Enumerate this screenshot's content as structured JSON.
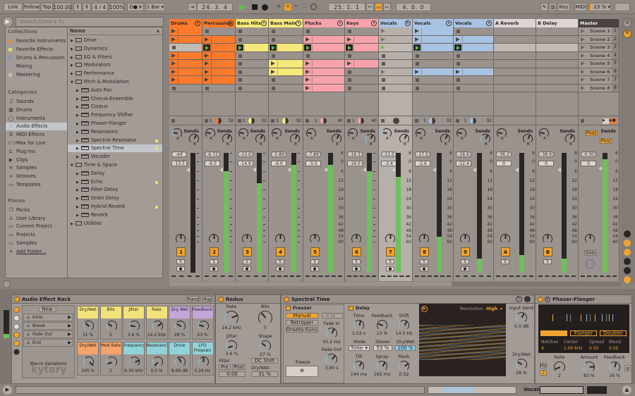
{
  "toolbar": {
    "link": "Link",
    "follow": "Follow",
    "tap": "Tap",
    "tempo": "100.00",
    "signature": "4 / 4",
    "groove": "100%",
    "metro": "O●",
    "quantize": "1 Bar",
    "arrangement_position": "24.  3.  4",
    "loop_start": "25.  1.  1",
    "loop_length": "4.  0.  0",
    "key": "Key",
    "midi": "MIDI",
    "cpu": "23 %",
    "accent": "#f0a430"
  },
  "browser": {
    "search_placeholder": "Search (Cmd + F)",
    "collections_header": "Collections",
    "collections": [
      {
        "label": "Favorite Instruments",
        "color": "#e8913a"
      },
      {
        "label": "Favorite Effects",
        "color": "#e8d95a"
      },
      {
        "label": "Drums & Percussion",
        "color": "#7c98c0"
      },
      {
        "label": "Mixing",
        "color": "#b094c0"
      },
      {
        "label": "Mastering",
        "color": "#c4bcb8"
      }
    ],
    "categories_header": "Categories",
    "categories": [
      {
        "label": "Sounds",
        "icon": "♫"
      },
      {
        "label": "Drums",
        "icon": "▦"
      },
      {
        "label": "Instruments",
        "icon": "◯"
      },
      {
        "label": "Audio Effects",
        "icon": "⫶",
        "selected": true
      },
      {
        "label": "MIDI Effects",
        "icon": "☰"
      },
      {
        "label": "Max for Live",
        "icon": "⊂⊃"
      },
      {
        "label": "Plug-Ins",
        "icon": "⊏"
      },
      {
        "label": "Clips",
        "icon": "▶"
      },
      {
        "label": "Samples",
        "icon": "≡"
      },
      {
        "label": "Grooves",
        "icon": "≈"
      },
      {
        "label": "Templates",
        "icon": "▭"
      }
    ],
    "places_header": "Places",
    "places": [
      {
        "label": "Packs",
        "icon": "❐"
      },
      {
        "label": "User Library",
        "icon": "♙"
      },
      {
        "label": "Current Project",
        "icon": "▭"
      },
      {
        "label": "Projects",
        "icon": "▭"
      },
      {
        "label": "Samples",
        "icon": "▭"
      },
      {
        "label": "Add Folder...",
        "icon": "+"
      }
    ],
    "name_header": "Name",
    "items": [
      {
        "label": "Drive",
        "type": "folder",
        "level": 0
      },
      {
        "label": "Dynamics",
        "type": "folder",
        "level": 0
      },
      {
        "label": "EQ & Filters",
        "type": "folder",
        "level": 0
      },
      {
        "label": "Modulators",
        "type": "folder",
        "level": 0
      },
      {
        "label": "Performance",
        "type": "folder",
        "level": 0
      },
      {
        "label": "Pitch & Modulation",
        "type": "folder",
        "level": 0,
        "open": true
      },
      {
        "label": "Auto Pan",
        "type": "device",
        "level": 1
      },
      {
        "label": "Chorus-Ensemble",
        "type": "device",
        "level": 1
      },
      {
        "label": "Corpus",
        "type": "device",
        "level": 1
      },
      {
        "label": "Frequency Shifter",
        "type": "device",
        "level": 1
      },
      {
        "label": "Phaser-Flanger",
        "type": "device",
        "level": 1
      },
      {
        "label": "Resonators",
        "type": "device",
        "level": 1
      },
      {
        "label": "Spectral Resonator",
        "type": "device",
        "level": 1,
        "new": true
      },
      {
        "label": "Spectral Time",
        "type": "device",
        "level": 1,
        "new": true,
        "selected": true
      },
      {
        "label": "Vocoder",
        "type": "device",
        "level": 1
      },
      {
        "label": "Time & Space",
        "type": "folder",
        "level": 0,
        "open": true
      },
      {
        "label": "Delay",
        "type": "device",
        "level": 1
      },
      {
        "label": "Echo",
        "type": "device",
        "level": 1,
        "new": true
      },
      {
        "label": "Filter Delay",
        "type": "device",
        "level": 1
      },
      {
        "label": "Grain Delay",
        "type": "device",
        "level": 1
      },
      {
        "label": "Hybrid Reverb",
        "type": "device",
        "level": 1,
        "new": true
      },
      {
        "label": "Reverb",
        "type": "device",
        "level": 1
      },
      {
        "label": "Utilities",
        "type": "folder",
        "level": 0
      }
    ]
  },
  "session": {
    "tracks": [
      {
        "name": "Drums",
        "color": "#fb7a2c",
        "slots": [
          "clip",
          "clip",
          "stop",
          "clip",
          "clip",
          "clip",
          "clip",
          "stop"
        ],
        "vol": "-Inf",
        "vol2": "-13.5",
        "num": "1",
        "meter": 0
      },
      {
        "name": "Percussion",
        "color": "#fb7a2c",
        "slots": [
          "stop",
          "clip",
          "playing",
          "clip",
          "clip",
          "clip",
          "clip",
          "stop"
        ],
        "vol": "-6.72",
        "vol2": "-6.0",
        "num": "2",
        "io": [
          "1",
          "32"
        ],
        "meter": 0.85
      },
      {
        "name": "Bass Hits",
        "color": "#f5e97a",
        "slots": [
          "stop",
          "stop",
          "playing",
          "stop",
          "stop",
          "stop",
          "stop",
          "stop"
        ],
        "vol": "-13.0",
        "vol2": "-14.9",
        "num": "3",
        "io": [
          "1",
          "32"
        ],
        "meter": 0.75
      },
      {
        "name": "Bass Main",
        "color": "#f5e97a",
        "slots": [
          "stop",
          "stop",
          "playing",
          "stop",
          "clip",
          "clip",
          "stop",
          "stop"
        ],
        "vol": "-5.89",
        "vol2": "-6.0",
        "num": "4",
        "io": [
          "1",
          "32"
        ],
        "meter": 0.9
      },
      {
        "name": "Plucks",
        "color": "#f6a3ab",
        "slots": [
          "stop",
          "clip",
          "playing",
          "stop",
          "clip",
          "clip",
          "clip",
          "clip"
        ],
        "vol": "-7.89",
        "vol2": "-5.5",
        "num": "5",
        "io": [
          "1",
          "40"
        ],
        "meter": 0.9,
        "scale": true
      },
      {
        "name": "Keys",
        "color": "#f6a3ab",
        "slots": [
          "stop",
          "clip",
          "playing",
          "stop",
          "clip",
          "stop",
          "stop",
          "stop"
        ],
        "vol": "-16.3",
        "vol2": "-16.0",
        "num": "6",
        "io": [
          "1",
          "40"
        ],
        "meter": 0.85
      },
      {
        "name": "Vocals",
        "color": "#a9c3e2",
        "group": true,
        "slots": [
          "gplay",
          "gplay",
          "gplaying",
          "gstop",
          "gstop",
          "gplay",
          "gstop",
          "gstop"
        ],
        "vol": "-11.5",
        "vol2": "-3.4",
        "num": "7",
        "meter": 0.8,
        "scale": true
      },
      {
        "name": "Vocals",
        "color": "#a9c3e2",
        "slots": [
          "clip",
          "clip",
          "playing",
          "stop",
          "stop",
          "clip",
          "stop",
          "stop"
        ],
        "vol": "-17.5",
        "vol2": "-2.6",
        "num": "8",
        "io": [
          "1",
          "32"
        ],
        "meter": 0.3,
        "scale": true
      },
      {
        "name": "Vocals",
        "color": "#a9c3e2",
        "slots": [
          "stop",
          "clip",
          "playing",
          "stop",
          "stop",
          "clip",
          "stop",
          "stop"
        ],
        "vol": "-16.6",
        "vol2": "-12.4",
        "num": "9",
        "io": [
          "1",
          "32"
        ],
        "meter": 0.12,
        "scale": true
      },
      {
        "name": "A Reverb",
        "color": "#ddd5d1",
        "return": true,
        "slots": [
          "",
          "",
          "",
          "",
          "",
          "",
          "",
          ""
        ],
        "vol": "-36.2",
        "vol2": "0",
        "num": "A",
        "meter": 0.15,
        "scale": true
      },
      {
        "name": "B Delay",
        "color": "#ddd5d1",
        "return": true,
        "slots": [
          "",
          "",
          "",
          "",
          "",
          "",
          "",
          ""
        ],
        "vol": "-38.9",
        "vol2": "0",
        "num": "B",
        "meter": 0.12,
        "scale": true
      },
      {
        "name": "Master",
        "color": "#4a4340",
        "master": true,
        "vol": "-0.30",
        "vol2": "0",
        "solo": "Solo",
        "post": "Post",
        "meter": 0.95,
        "scale": true
      }
    ],
    "scenes": [
      "Scene 1",
      "Scene 2",
      "Scene 3",
      "Scene 4",
      "Scene 5",
      "Scene 6",
      "Scene 7",
      "Scene 8"
    ],
    "scene_numbers": [
      "1",
      "2",
      "3",
      "4",
      "5",
      "6",
      "7",
      "8"
    ],
    "sends_label": "Sends",
    "send_a": "A",
    "send_b": "B",
    "solo_label": "S",
    "meter_scale": [
      "6",
      "0",
      "6",
      "12",
      "18",
      "24",
      "30",
      "36",
      "42",
      "48",
      "54",
      "60"
    ]
  },
  "devices": {
    "rack": {
      "title": "Audio Effect Rack",
      "rand": "Rand",
      "map": "Map",
      "new": "New",
      "variations": [
        "Intro",
        "Break",
        "Fade Out",
        "End"
      ],
      "variations_label": "Macro Variations",
      "watermark": "kytary",
      "macros": [
        {
          "label": "Dry/Wet",
          "value": "31 %",
          "color": "#f2e27a",
          "level": 0.31
        },
        {
          "label": "Bits",
          "value": "5",
          "color": "#f2e27a",
          "level": 0.3
        },
        {
          "label": "Jitter",
          "value": "3.6 %",
          "color": "#f2e27a",
          "level": 0.2
        },
        {
          "label": "Rate",
          "value": "14.2 kHz",
          "color": "#f2e27a",
          "level": 0.7
        },
        {
          "label": "Dry Wet",
          "value": "28 %",
          "color": "#c3a6d8",
          "level": 0.28
        },
        {
          "label": "Feedback",
          "value": "23 %",
          "color": "#c3a6d8",
          "level": 0.23
        },
        {
          "label": "Dry/Wet",
          "value": "100 %",
          "color": "#f5a36a",
          "level": 1
        },
        {
          "label": "Mod Rate",
          "value": "2",
          "color": "#f5a36a",
          "level": 0.1
        },
        {
          "label": "Frequency",
          "value": "6.30 kHz",
          "color": "#8fd3d8",
          "level": 0.75
        },
        {
          "label": "Resonance",
          "value": "0.0 %",
          "color": "#8fd3d8",
          "level": 0
        },
        {
          "label": "Drive",
          "value": "8.69 dB",
          "color": "#8fd3d8",
          "level": 0.4
        },
        {
          "label": "LFO Frequen",
          "value": "0.26 Hz",
          "color": "#8fd3d8",
          "level": 0.5
        }
      ]
    },
    "redux": {
      "title": "Redux",
      "rate_label": "Rate",
      "rate": "14.2 kHz",
      "bits_label": "Bits",
      "bits": "5",
      "jitter_label": "Jitter",
      "jitter": "3.6 %",
      "shape_label": "Shape",
      "shape": "27 %",
      "filter_label": "Filter",
      "pre": "Pre",
      "post": "Post",
      "filter_value": "0.00",
      "dc_shift": "DC Shift",
      "drywet_label": "Dry/Wet",
      "drywet": "31 %"
    },
    "spectral_time": {
      "title": "Spectral Time",
      "freezer": "Freezer",
      "manual": "Manual",
      "retrigger": "Retrigger",
      "onsets": "Onsets",
      "sync": "Sync",
      "freeze_label": "Freeze",
      "freeze_symbol": "✳",
      "fade_in_label": "Fade In",
      "fade_in": "55.2 ms",
      "fade_out_label": "Fade Out",
      "fade_out": "3.90 s",
      "delay": "Delay",
      "time_label": "Time",
      "time": "1.03 s",
      "feedback_label": "Feedback",
      "feedback": "23 %",
      "shift_label": "Shift",
      "shift": "14.0 Hz",
      "mode_label": "Mode",
      "mode": "Time",
      "stereo_label": "Stereo",
      "stereo": "53 %",
      "drywet_label": "Dry/Wet",
      "drywet": "100 %",
      "tilt_label": "Tilt",
      "tilt": "144 ms",
      "spray_label": "Spray",
      "spray": "165 ms",
      "mask_label": "Mask",
      "mask": "0.52",
      "resolution_label": "Resolution",
      "resolution": "High",
      "input_send_label": "Input Send",
      "input_send": "0.0 dB",
      "out_drywet_label": "Dry/Wet",
      "out_drywet": "28 %"
    },
    "phaser": {
      "title": "Phaser-Flanger",
      "modes": [
        "Phaser",
        "Flanger",
        "Doubler"
      ],
      "active_mode": "Phaser",
      "notches_label": "Notches",
      "notches": "4",
      "center_label": "Center",
      "center": "1.00 kHz",
      "spread_label": "Spread",
      "spread": "0.50",
      "blend_label": "Blend",
      "blend": "0.00",
      "hz": "Hz",
      "note": "♪",
      "rate_label": "Rate",
      "rate": "2",
      "amount_label": "Amount",
      "amount": "83 %",
      "feedback_label": "Feedback",
      "feedback": "16 %"
    }
  },
  "statusbar": {
    "track": "Vocals"
  }
}
